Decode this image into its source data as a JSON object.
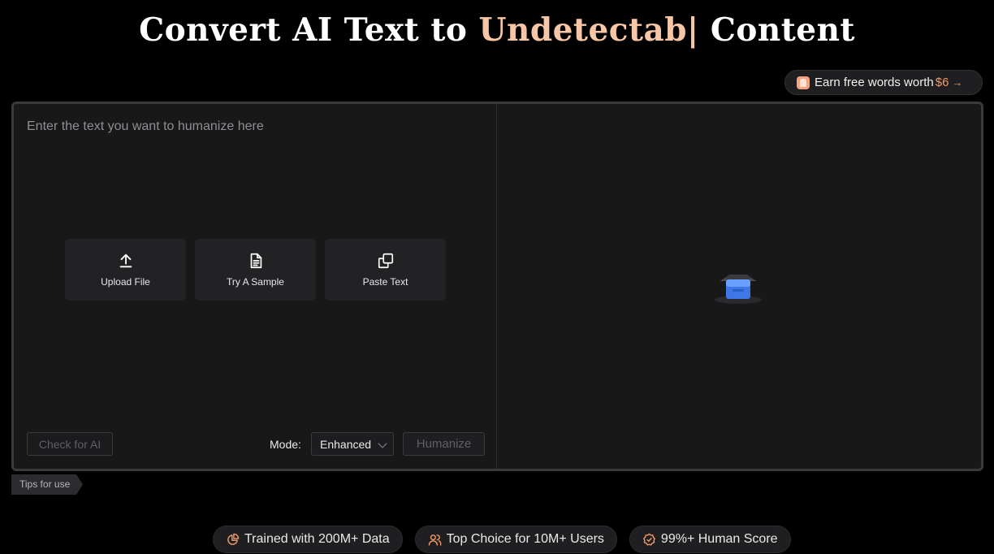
{
  "header": {
    "title_pre": "Convert AI Text to ",
    "title_highlight": "Undetectab|",
    "title_post": " Content"
  },
  "promo": {
    "label": "Earn free words worth",
    "amount": "$6",
    "arrow": "→",
    "icon": "gift-icon"
  },
  "editor": {
    "placeholder": "Enter the text you want to humanize here",
    "actions": [
      {
        "label": "Upload File",
        "icon": "upload-icon"
      },
      {
        "label": "Try A Sample",
        "icon": "document-icon"
      },
      {
        "label": "Paste Text",
        "icon": "copy-icon"
      }
    ],
    "check_ai_label": "Check for AI",
    "mode_label": "Mode:",
    "mode_value": "Enhanced",
    "humanize_label": "Humanize"
  },
  "output": {
    "empty_icon": "empty-box-illustration"
  },
  "tips_label": "Tips for use",
  "features": [
    {
      "label": "Trained with 200M+ Data",
      "icon": "pie-chart-icon"
    },
    {
      "label": "Top Choice for 10M+ Users",
      "icon": "users-icon"
    },
    {
      "label": "99%+ Human Score",
      "icon": "check-badge-icon"
    }
  ],
  "colors": {
    "background": "#000000",
    "accent": "#f39a66",
    "title_highlight": "#f7c6a6",
    "panel": "#181818"
  }
}
